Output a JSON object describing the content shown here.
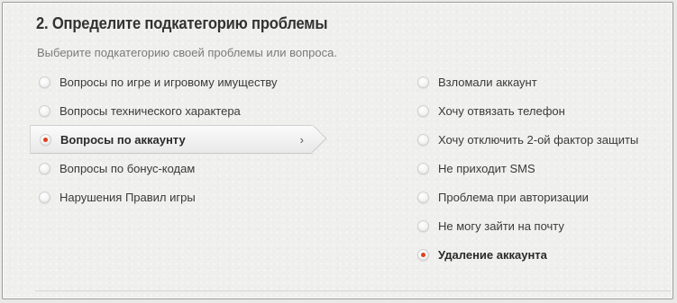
{
  "section": {
    "title": "2. Определите подкатегорию проблемы",
    "subtitle": "Выберите подкатегорию своей проблемы или вопроса."
  },
  "left_options": [
    {
      "label": "Вопросы по игре и игровому имуществу",
      "selected": false
    },
    {
      "label": "Вопросы технического характера",
      "selected": false
    },
    {
      "label": "Вопросы по аккаунту",
      "selected": true
    },
    {
      "label": "Вопросы по бонус-кодам",
      "selected": false
    },
    {
      "label": "Нарушения Правил игры",
      "selected": false
    }
  ],
  "right_options": [
    {
      "label": "Взломали аккаунт",
      "selected": false
    },
    {
      "label": "Хочу отвязать телефон",
      "selected": false
    },
    {
      "label": "Хочу отключить 2-ой фактор защиты",
      "selected": false
    },
    {
      "label": "Не приходит SMS",
      "selected": false
    },
    {
      "label": "Проблема при авторизации",
      "selected": false
    },
    {
      "label": "Не могу зайти на почту",
      "selected": false
    },
    {
      "label": "Удаление аккаунта",
      "selected": true
    }
  ],
  "icons": {
    "chevron": "chevron-right-icon",
    "radio_selected_color": "#e0401f"
  }
}
